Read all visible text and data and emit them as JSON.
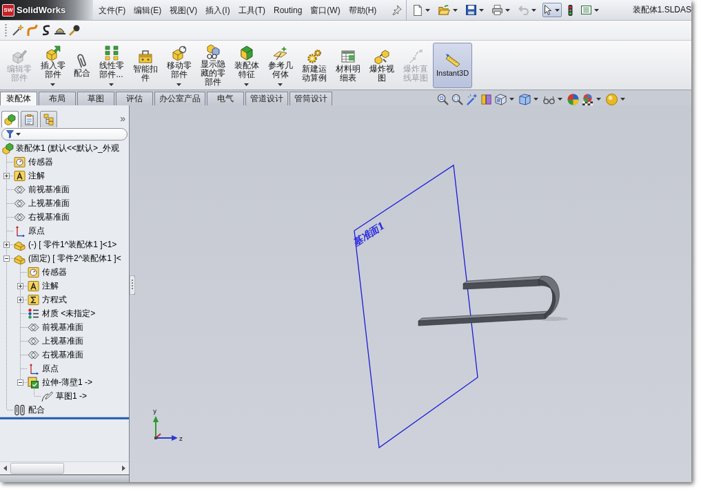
{
  "title_bar": {
    "logo_mark": "SW",
    "logo": "SolidWorks",
    "menus": [
      "文件(F)",
      "编辑(E)",
      "视图(V)",
      "插入(I)",
      "工具(T)",
      "Routing",
      "窗口(W)",
      "帮助(H)"
    ],
    "quick_access": {
      "undo": {
        "disabled": true
      },
      "select": {
        "on": true
      }
    },
    "document_title": "装配体1.SLDAS"
  },
  "command_manager": {
    "buttons": [
      {
        "label": "编辑零部件",
        "kind": "edit",
        "disabled": true,
        "on": false,
        "dropdown": false
      },
      {
        "label": "插入零部件",
        "kind": "insert",
        "disabled": false,
        "on": false,
        "dropdown": true
      },
      {
        "label": "配合",
        "kind": "mate",
        "disabled": false,
        "on": false,
        "dropdown": false
      },
      {
        "label": "线性零部件...",
        "kind": "pattern",
        "disabled": false,
        "on": false,
        "dropdown": true
      },
      {
        "label": "智能扣件",
        "kind": "fastener",
        "disabled": false,
        "on": false,
        "dropdown": false
      },
      {
        "label": "移动零部件",
        "kind": "move",
        "disabled": false,
        "on": false,
        "dropdown": true
      },
      {
        "label": "显示隐藏的零部件",
        "kind": "show",
        "disabled": false,
        "on": false,
        "dropdown": false
      },
      {
        "label": "装配体特征",
        "kind": "feature",
        "disabled": false,
        "on": false,
        "dropdown": true
      },
      {
        "label": "参考几何体",
        "kind": "geometry",
        "disabled": false,
        "on": false,
        "dropdown": true
      },
      {
        "label": "新建运动算例",
        "kind": "motion",
        "disabled": false,
        "on": false,
        "dropdown": false
      },
      {
        "label": "材料明细表",
        "kind": "bom",
        "disabled": false,
        "on": false,
        "dropdown": false
      },
      {
        "label": "爆炸视图",
        "kind": "explode",
        "disabled": false,
        "on": false,
        "dropdown": false
      },
      {
        "label": "爆炸直线草图",
        "kind": "explodeline",
        "disabled": true,
        "on": false,
        "dropdown": false
      },
      {
        "label": "Instant3D",
        "kind": "instant3d",
        "disabled": false,
        "on": true,
        "dropdown": false
      }
    ],
    "tabs": [
      {
        "label": "装配体",
        "selected": true
      },
      {
        "label": "布局",
        "selected": false
      },
      {
        "label": "草图",
        "selected": false
      },
      {
        "label": "评估",
        "selected": false
      },
      {
        "label": "办公室产品",
        "selected": false
      },
      {
        "label": "电气",
        "selected": false
      },
      {
        "label": "管道设计",
        "selected": false
      },
      {
        "label": "管筒设计",
        "selected": false
      }
    ]
  },
  "feature_manager": {
    "tabs": [
      {
        "kind": "tree",
        "selected": true
      },
      {
        "kind": "property",
        "selected": false
      },
      {
        "kind": "config",
        "selected": false
      }
    ],
    "more": "»",
    "tree": [
      {
        "label": "装配体1 (默认<<默认>_外观",
        "kind": "assembly",
        "children": [
          {
            "label": "传感器",
            "kind": "sensor"
          },
          {
            "label": "注解",
            "kind": "annotation",
            "expanded": false
          },
          {
            "label": "前视基准面",
            "kind": "plane"
          },
          {
            "label": "上视基准面",
            "kind": "plane"
          },
          {
            "label": "右视基准面",
            "kind": "plane"
          },
          {
            "label": "原点",
            "kind": "origin"
          },
          {
            "label": "(-) [ 零件1^装配体1 ]<1>",
            "kind": "part",
            "expanded": false
          },
          {
            "label": "(固定) [ 零件2^装配体1 ]<",
            "kind": "part",
            "expanded": true,
            "children": [
              {
                "label": "传感器",
                "kind": "sensor"
              },
              {
                "label": "注解",
                "kind": "annotation",
                "expanded": false
              },
              {
                "label": "方程式",
                "kind": "equation",
                "expanded": false
              },
              {
                "label": "材质 <未指定>",
                "kind": "material"
              },
              {
                "label": "前视基准面",
                "kind": "plane"
              },
              {
                "label": "上视基准面",
                "kind": "plane"
              },
              {
                "label": "右视基准面",
                "kind": "plane"
              },
              {
                "label": "原点",
                "kind": "origin"
              },
              {
                "label": "拉伸-薄壁1 ->",
                "kind": "extrude",
                "expanded": true,
                "children": [
                  {
                    "label": "草图1 ->",
                    "kind": "sketch"
                  }
                ]
              }
            ]
          },
          {
            "label": "配合",
            "kind": "mates"
          }
        ]
      }
    ]
  },
  "viewport": {
    "plane_label": "基准面1",
    "triad_labels": [
      "y",
      "z"
    ]
  }
}
